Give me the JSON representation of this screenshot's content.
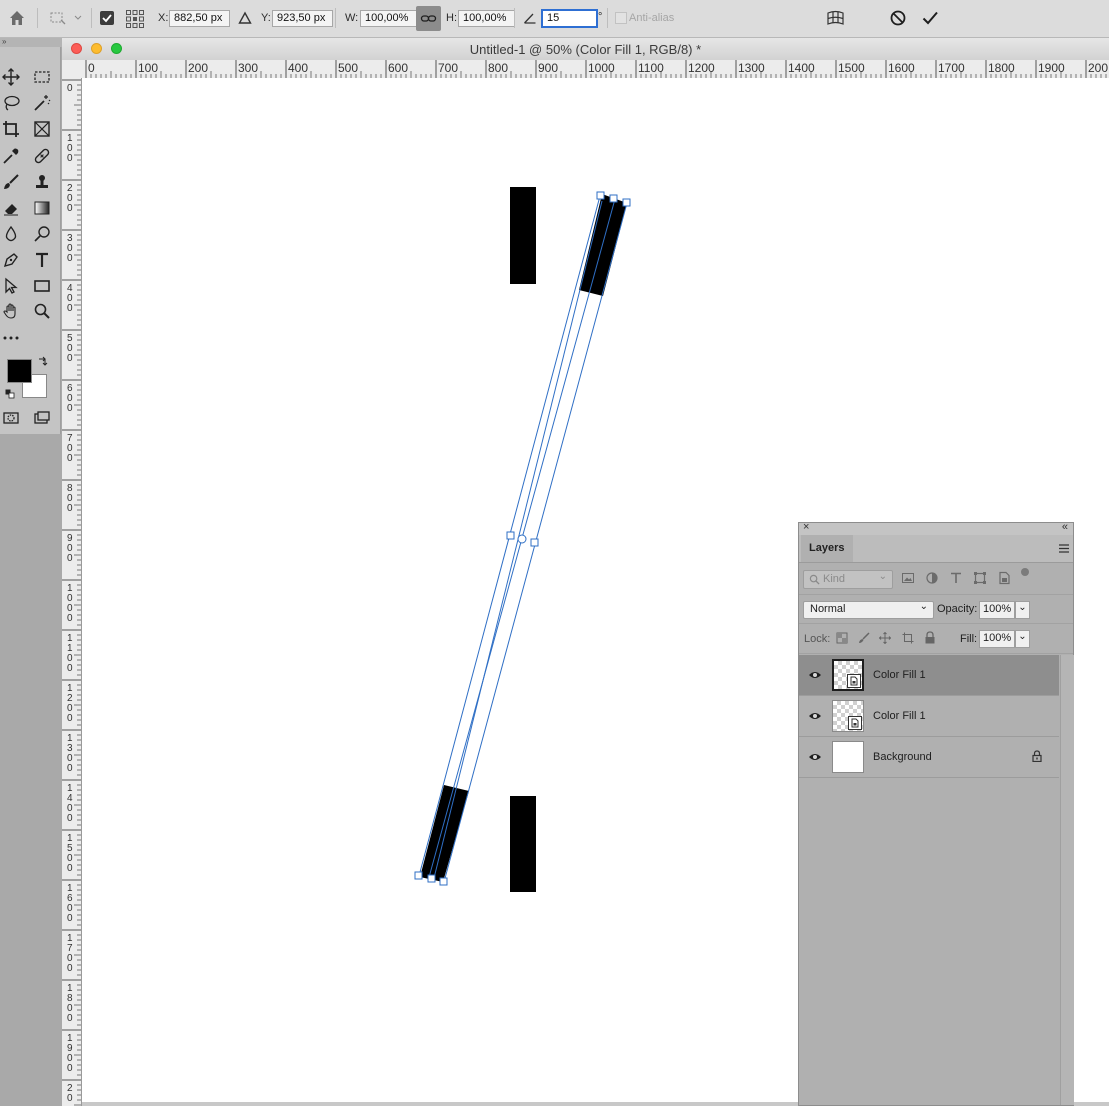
{
  "options_bar": {
    "x_label": "X:",
    "x_value": "882,50 px",
    "y_label": "Y:",
    "y_value": "923,50 px",
    "w_label": "W:",
    "w_value": "100,00%",
    "h_label": "H:",
    "h_value": "100,00%",
    "angle_value": "15",
    "angle_unit": "°",
    "antialias_label": "Anti-alias",
    "icons": [
      "home-icon",
      "transform-tool-icon",
      "show-transform-controls-checkbox",
      "reference-point-icon",
      "delta-icon",
      "link-icon",
      "angle-icon",
      "warp-icon",
      "cancel-icon",
      "commit-icon"
    ]
  },
  "document": {
    "title": "Untitled-1 @ 50% (Color Fill 1, RGB/8) *",
    "ruler_h_labels": [
      "0",
      "100",
      "200",
      "300",
      "400",
      "500",
      "600",
      "700",
      "800",
      "900",
      "1000",
      "1100",
      "1200",
      "1300",
      "1400",
      "1500",
      "1600",
      "1700",
      "1800",
      "1900",
      "200"
    ],
    "ruler_v_labels": [
      "0",
      "100",
      "200",
      "300",
      "400",
      "500",
      "600",
      "700",
      "800",
      "900",
      "1000",
      "1100",
      "1200",
      "1300",
      "1400",
      "1500",
      "1600",
      "1700",
      "1800",
      "1900",
      "20"
    ]
  },
  "toolbar": {
    "tools": [
      "move-tool-icon",
      "marquee-tool-icon",
      "lasso-tool-icon",
      "magic-wand-tool-icon",
      "crop-tool-icon",
      "frame-tool-icon",
      "eyedropper-tool-icon",
      "healing-brush-tool-icon",
      "brush-tool-icon",
      "stamp-tool-icon",
      "eraser-tool-icon",
      "gradient-tool-icon",
      "blur-tool-icon",
      "dodge-tool-icon",
      "pen-tool-icon",
      "type-tool-icon",
      "path-selection-tool-icon",
      "rectangle-tool-icon",
      "hand-tool-icon",
      "zoom-tool-icon",
      "more-tools-icon"
    ],
    "foreground_color": "#000000",
    "background_color": "#ffffff"
  },
  "layers_panel": {
    "tab": "Layers",
    "filter_placeholder": "Kind",
    "blend_mode": "Normal",
    "opacity_label": "Opacity:",
    "opacity_value": "100%",
    "lock_label": "Lock:",
    "fill_label": "Fill:",
    "fill_value": "100%",
    "layers": [
      {
        "name": "Color Fill 1",
        "selected": true,
        "type": "smart-object"
      },
      {
        "name": "Color Fill 1",
        "selected": false,
        "type": "smart-object"
      },
      {
        "name": "Background",
        "selected": false,
        "type": "background",
        "locked": true
      }
    ]
  },
  "colors": {
    "transform_handle": "#2f6fc5",
    "selected_layer": "#8e8e8e",
    "ui_panel": "#b0b0b0"
  }
}
